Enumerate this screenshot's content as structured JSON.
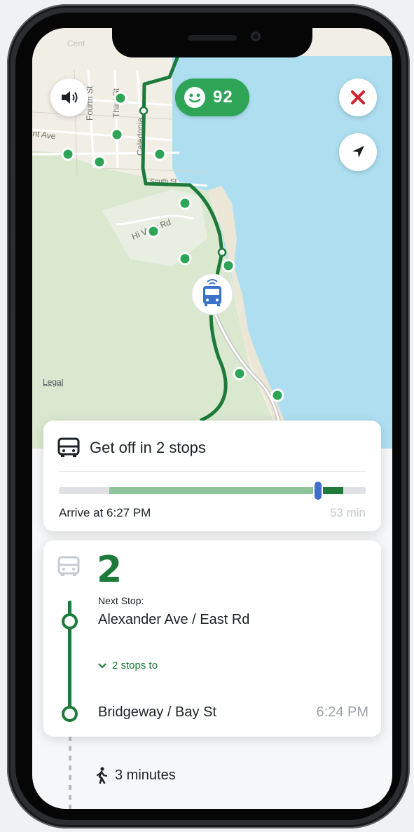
{
  "map": {
    "legal_label": "Legal",
    "street_labels": [
      "Fourth St",
      "Third St",
      "nt Ave",
      "Caledonia",
      "South St",
      "Hi View Rd",
      "Cent"
    ]
  },
  "controls": {
    "sound_icon": "speaker-icon",
    "score_icon": "smiley-face-icon",
    "score_value": "92",
    "close_icon": "close-x-icon",
    "locate_icon": "location-arrow-icon"
  },
  "trip_card": {
    "icon": "bus-icon",
    "title": "Get off in 2 stops",
    "arrive_text": "Arrive at 6:27 PM",
    "duration_text": "53 min",
    "progress_fraction": 0.87
  },
  "route_card": {
    "route_number": "2",
    "next_stop_label": "Next Stop:",
    "next_stop_name": "Alexander Ave / East Rd",
    "expand_label": "2 stops to",
    "destination_name": "Bridgeway / Bay St",
    "destination_time": "6:24 PM"
  },
  "walk": {
    "icon": "walking-person-icon",
    "text": "3 minutes"
  },
  "colors": {
    "accent_green": "#1d7a3a",
    "score_green": "#2ea456",
    "close_red": "#d0212e",
    "progress_blue": "#3f6fc9",
    "water": "#aedff1",
    "land": "#f1eee6",
    "park": "#d9e8cf"
  }
}
